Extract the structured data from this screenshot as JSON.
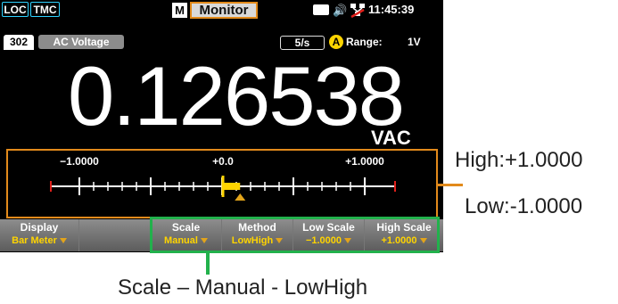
{
  "status": {
    "loc": "LOC",
    "tmc": "TMC",
    "mode_icon": "M",
    "title": "Monitor",
    "time": "11:45:39"
  },
  "function_bar": {
    "channel": "302",
    "function": "AC Voltage",
    "rate": "5/s",
    "auto_icon": "A",
    "range_label": "Range:",
    "range_value": "1V"
  },
  "reading": {
    "value": "0.126538",
    "unit": "VAC"
  },
  "bar_meter": {
    "low_label": "−1.0000",
    "mid_label": "+0.0",
    "high_label": "+1.0000",
    "low": -1.0,
    "high": 1.0,
    "value": 0.126538
  },
  "softkeys": [
    {
      "title": "Display",
      "value": "Bar Meter"
    },
    {
      "title": "",
      "value": ""
    },
    {
      "title": "Scale",
      "value": "Manual"
    },
    {
      "title": "Method",
      "value": "LowHigh"
    },
    {
      "title": "Low Scale",
      "value": "−1.0000"
    },
    {
      "title": "High Scale",
      "value": "+1.0000"
    }
  ],
  "callouts": {
    "high": "High:+1.0000",
    "low": "Low:-1.0000",
    "scale": "Scale – Manual - LowHigh"
  },
  "colors": {
    "accent_orange": "#e28a1b",
    "highlight_green": "#22b14c",
    "value_yellow": "#ffd400",
    "loc_border": "#2fd2ff"
  }
}
